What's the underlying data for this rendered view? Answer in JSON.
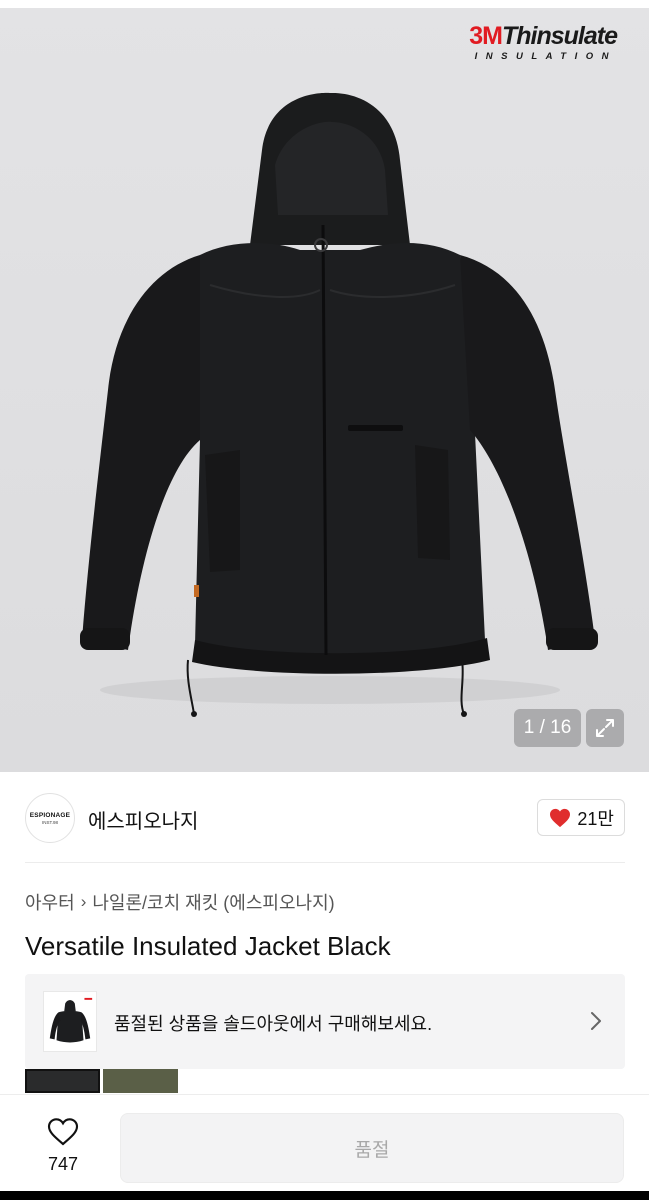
{
  "gallery": {
    "logo_brand_red": "3M",
    "logo_brand_dark": "Thinsulate",
    "logo_sub": "INSULATION",
    "counter": "1 / 16",
    "expand_icon": "expand-icon"
  },
  "seller": {
    "avatar_text": "ESPIONAGE",
    "avatar_subtext": "INST.98",
    "name": "에스피오나지",
    "likes": "21만",
    "heart_color": "#e02d2d"
  },
  "product": {
    "breadcrumb": [
      "아우터",
      "나일론/코치 재킷 (에스피오나지)"
    ],
    "title": "Versatile Insulated Jacket Black"
  },
  "banner": {
    "text": "품절된 상품을 솔드아웃에서 구매해보세요."
  },
  "bottom_bar": {
    "wish_count": "747",
    "button_label": "품절"
  },
  "colors": {
    "brand_red": "#e11b22",
    "disabled_text": "#a8a8a8"
  }
}
